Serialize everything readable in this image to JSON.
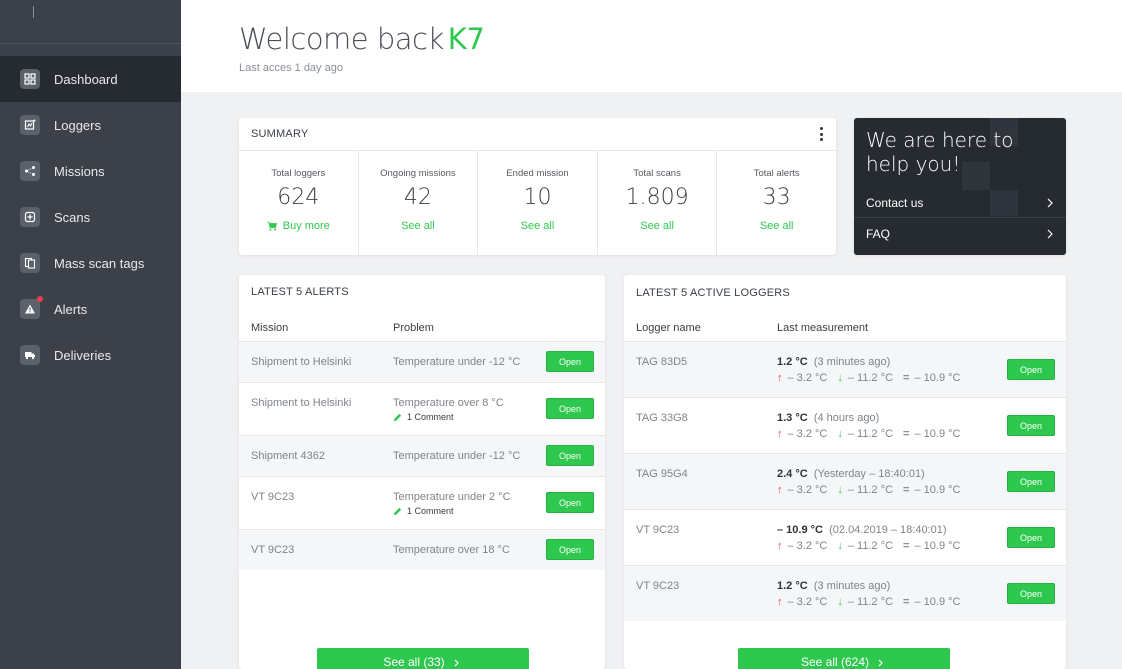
{
  "sidebar": {
    "items": [
      {
        "label": "Dashboard",
        "active": true,
        "icon": "dashboard-icon"
      },
      {
        "label": "Loggers",
        "icon": "logger-icon"
      },
      {
        "label": "Missions",
        "icon": "missions-icon"
      },
      {
        "label": "Scans",
        "icon": "scan-icon"
      },
      {
        "label": "Mass scan tags",
        "icon": "mass-scan-icon"
      },
      {
        "label": "Alerts",
        "icon": "alert-icon",
        "notification": true
      },
      {
        "label": "Deliveries",
        "icon": "truck-icon"
      }
    ]
  },
  "header": {
    "welcome": "Welcome back",
    "user": "K7",
    "last_access": "Last acces 1 day ago"
  },
  "summary": {
    "title": "SUMMARY",
    "stats": [
      {
        "label": "Total loggers",
        "value": "624",
        "link": "Buy more"
      },
      {
        "label": "Ongoing missions",
        "value": "42",
        "link": "See all"
      },
      {
        "label": "Ended mission",
        "value": "10",
        "link": "See all"
      },
      {
        "label": "Total scans",
        "value": "1.809",
        "link": "See all"
      },
      {
        "label": "Total alerts",
        "value": "33",
        "link": "See all"
      }
    ]
  },
  "help": {
    "title_line1": "We are here to",
    "title_line2": "help you!",
    "contact": "Contact us",
    "faq": "FAQ"
  },
  "alerts": {
    "title": "LATEST 5 ALERTS",
    "col_mission": "Mission",
    "col_problem": "Problem",
    "open_label": "Open",
    "comment_label": "1 Comment",
    "rows": [
      {
        "mission": "Shipment to Helsinki",
        "problem": "Temperature under -12 °C",
        "comment": false
      },
      {
        "mission": "Shipment to Helsinki",
        "problem": "Temperature over 8 °C",
        "comment": true
      },
      {
        "mission": "Shipment 4362",
        "problem": "Temperature under -12 °C",
        "comment": false
      },
      {
        "mission": "VT 9C23",
        "problem": "Temperature under 2 °C",
        "comment": true
      },
      {
        "mission": "VT 9C23",
        "problem": "Temperature over 18 °C",
        "comment": false
      }
    ],
    "see_all": "See all (33)"
  },
  "loggers": {
    "title": "LATEST 5 ACTIVE LOGGERS",
    "col_name": "Logger name",
    "col_measurement": "Last measurement",
    "open_label": "Open",
    "rows": [
      {
        "name": "TAG 83D5",
        "temp": "1.2 °C",
        "when": "(3 minutes ago)",
        "max": "– 3.2 °C",
        "min": "– 11.2 °C",
        "avg": "– 10.9 °C"
      },
      {
        "name": "TAG 33G8",
        "temp": "1.3 °C",
        "when": "(4 hours ago)",
        "max": "– 3.2 °C",
        "min": "– 11.2 °C",
        "avg": "– 10.9 °C"
      },
      {
        "name": "TAG 95G4",
        "temp": "2.4 °C",
        "when": "(Yesterday – 18:40:01)",
        "max": "– 3.2 °C",
        "min": "– 11.2 °C",
        "avg": "– 10.9 °C"
      },
      {
        "name": "VT 9C23",
        "temp": "– 10.9 °C",
        "when": "(02.04.2019 – 18:40:01)",
        "max": "– 3.2 °C",
        "min": "– 11.2 °C",
        "avg": "– 10.9 °C"
      },
      {
        "name": "VT 9C23",
        "temp": "1.2 °C",
        "when": "(3 minutes ago)",
        "max": "– 3.2 °C",
        "min": "– 11.2 °C",
        "avg": "– 10.9 °C"
      }
    ],
    "see_all": "See all (624)"
  },
  "colors": {
    "accent": "#2fc84f",
    "sidebar": "#3b4049",
    "sidebar_active": "#262a31",
    "alert_dot": "#e8404a"
  }
}
